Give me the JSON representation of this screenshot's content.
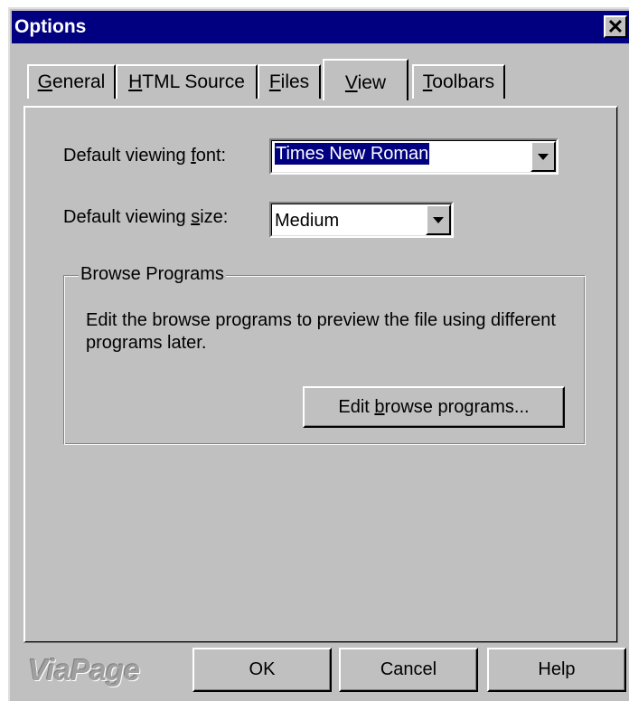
{
  "window": {
    "title": "Options",
    "close_glyph": "✕"
  },
  "tabs": [
    {
      "pre": "",
      "u": "G",
      "post": "eneral",
      "active": false
    },
    {
      "pre": "",
      "u": "H",
      "post": "TML Source",
      "active": false
    },
    {
      "pre": "",
      "u": "F",
      "post": "iles",
      "active": false
    },
    {
      "pre": "",
      "u": "V",
      "post": "iew",
      "active": true
    },
    {
      "pre": "",
      "u": "T",
      "post": "oolbars",
      "active": false
    }
  ],
  "view": {
    "font_label": {
      "pre": "Default viewing ",
      "u": "f",
      "post": "ont:"
    },
    "font_value": "Times New Roman",
    "size_label": {
      "pre": "Default viewing ",
      "u": "s",
      "post": "ize:"
    },
    "size_value": "Medium",
    "group": {
      "title": "Browse Programs",
      "description": "Edit the browse programs to preview the file using different programs later.",
      "button": {
        "pre": "Edit ",
        "u": "b",
        "post": "rowse programs..."
      }
    }
  },
  "footer": {
    "brand": "ViaPage",
    "ok_label": "OK",
    "cancel_label": "Cancel",
    "help_label": "Help"
  },
  "icons": {
    "close": "close-icon",
    "dropdown": "chevron-down-icon"
  }
}
